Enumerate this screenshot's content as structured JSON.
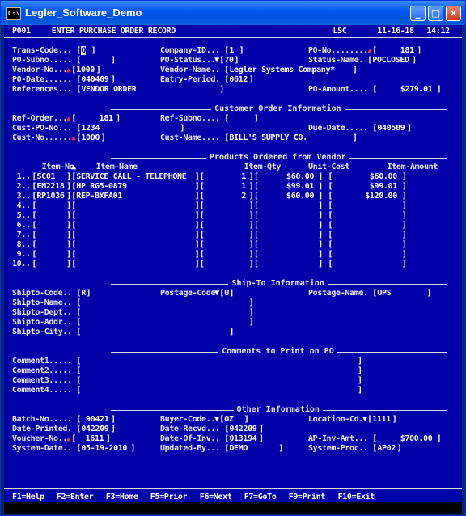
{
  "window": {
    "title": "Legler_Software_Demo",
    "icon_text": "C:\\"
  },
  "header": {
    "program": "P001",
    "screen_title": "ENTER PURCHASE ORDER RECORD",
    "user": "LSC",
    "date": "11-16-18",
    "time": "14:12"
  },
  "top_fields": {
    "trans_code": {
      "label": "Trans-Code...",
      "value": "Q"
    },
    "company_id": {
      "label": "Company-ID...",
      "value": "1"
    },
    "po_no": {
      "label": "PO-No........",
      "value": "181"
    },
    "po_subno": {
      "label": "PO-Subno.....",
      "value": ""
    },
    "po_status": {
      "label": "PO-Status...",
      "value": "70"
    },
    "status_name": {
      "label": "Status-Name.",
      "value": "POCLOSED"
    },
    "vendor_no": {
      "label": "Vendor-No...",
      "value": "1000"
    },
    "vendor_name": {
      "label": "Vendor-Name..",
      "value": "Legler Systems Company*"
    },
    "po_date": {
      "label": "PO-Date......",
      "value": "040409"
    },
    "entry_period": {
      "label": "Entry-Period.",
      "value": "0612"
    },
    "references": {
      "label": "References...",
      "value": "VENDOR ORDER"
    },
    "po_amount": {
      "label": "PO-Amount....",
      "value": "$279.01"
    }
  },
  "customer_order": {
    "section_title": "Customer Order Information",
    "ref_order": {
      "label": "Ref-Order...",
      "value": "181"
    },
    "ref_subno": {
      "label": "Ref-Subno....",
      "value": ""
    },
    "cust_po_no": {
      "label": "Cust-PO-No...",
      "value": "1234"
    },
    "due_date": {
      "label": "Due-Date.....",
      "value": "040509"
    },
    "cust_no": {
      "label": "Cust-No......",
      "value": "1000"
    },
    "cust_name": {
      "label": "Cust-Name....",
      "value": "BILL'S SUPPLY CO."
    }
  },
  "products": {
    "section_title": "Products Ordered from Vendor",
    "columns": [
      "Item-No",
      "Item-Name",
      "Item-Qty",
      "Unit-Cost",
      "Item-Amount"
    ],
    "rows": [
      {
        "n": "1",
        "item_no": "SC01",
        "item_name": "SERVICE CALL - TELEPHONE",
        "qty": "1",
        "unit_cost": "$60.00",
        "amount": "$60.00"
      },
      {
        "n": "2",
        "item_no": "EM2218",
        "item_name": "HP RG5-0879",
        "qty": "1",
        "unit_cost": "$99.01",
        "amount": "$99.01"
      },
      {
        "n": "3",
        "item_no": "RP1036",
        "item_name": "REP-BXFA01",
        "qty": "2",
        "unit_cost": "$60.00",
        "amount": "$120.00"
      },
      {
        "n": "4",
        "item_no": "",
        "item_name": "",
        "qty": "",
        "unit_cost": "",
        "amount": ""
      },
      {
        "n": "5",
        "item_no": "",
        "item_name": "",
        "qty": "",
        "unit_cost": "",
        "amount": ""
      },
      {
        "n": "6",
        "item_no": "",
        "item_name": "",
        "qty": "",
        "unit_cost": "",
        "amount": ""
      },
      {
        "n": "7",
        "item_no": "",
        "item_name": "",
        "qty": "",
        "unit_cost": "",
        "amount": ""
      },
      {
        "n": "8",
        "item_no": "",
        "item_name": "",
        "qty": "",
        "unit_cost": "",
        "amount": ""
      },
      {
        "n": "9",
        "item_no": "",
        "item_name": "",
        "qty": "",
        "unit_cost": "",
        "amount": ""
      },
      {
        "n": "10",
        "item_no": "",
        "item_name": "",
        "qty": "",
        "unit_cost": "",
        "amount": ""
      }
    ]
  },
  "ship_to": {
    "section_title": "Ship-To Information",
    "shipto_code": {
      "label": "Shipto-Code..",
      "value": "R"
    },
    "postage_code": {
      "label": "Postage-Code",
      "value": "U"
    },
    "postage_name": {
      "label": "Postage-Name.",
      "value": "UPS"
    },
    "shipto_name": {
      "label": "Shipto-Name..",
      "value": ""
    },
    "shipto_dept": {
      "label": "Shipto-Dept..",
      "value": ""
    },
    "shipto_addr": {
      "label": "Shipto-Addr..",
      "value": ""
    },
    "shipto_city": {
      "label": "Shipto-City..",
      "value": ""
    }
  },
  "comments": {
    "section_title": "Comments to Print on PO",
    "lines": [
      {
        "label": "Comment1.....",
        "value": ""
      },
      {
        "label": "Comment2.....",
        "value": ""
      },
      {
        "label": "Comment3.....",
        "value": ""
      },
      {
        "label": "Comment4.....",
        "value": ""
      }
    ]
  },
  "other": {
    "section_title": "Other Information",
    "batch_no": {
      "label": "Batch-No.....",
      "value": "90421"
    },
    "buyer_code": {
      "label": "Buyer-Code..",
      "value": "OZ"
    },
    "location_cd": {
      "label": "Location-Cd.",
      "value": "1111"
    },
    "date_printed": {
      "label": "Date-Printed.",
      "value": "042209"
    },
    "date_recvd": {
      "label": "Date-Recvd...",
      "value": "042209"
    },
    "voucher_no": {
      "label": "Voucher-No..",
      "value": "1611"
    },
    "date_of_inv": {
      "label": "Date-Of-Inv..",
      "value": "013194"
    },
    "ap_inv_amt": {
      "label": "AP-Inv-Amt...",
      "value": "$700.00"
    },
    "system_date": {
      "label": "System-Date..",
      "value": "05-19-2010"
    },
    "updated_by": {
      "label": "Updated-By...",
      "value": "DEMO"
    },
    "system_proc": {
      "label": "System-Proc..",
      "value": "AP02"
    }
  },
  "function_keys": [
    {
      "key": "F1",
      "label": "Help"
    },
    {
      "key": "F2",
      "label": "Enter"
    },
    {
      "key": "F3",
      "label": "Home"
    },
    {
      "key": "F5",
      "label": "Prior"
    },
    {
      "key": "F6",
      "label": "Next"
    },
    {
      "key": "F7",
      "label": "GoTo"
    },
    {
      "key": "F9",
      "label": "Print"
    },
    {
      "key": "F10",
      "label": "Exit"
    }
  ],
  "colors": {
    "console_bg": "#0000a8",
    "text": "#e8e8e8",
    "required_marker": "#ff2a2a"
  }
}
